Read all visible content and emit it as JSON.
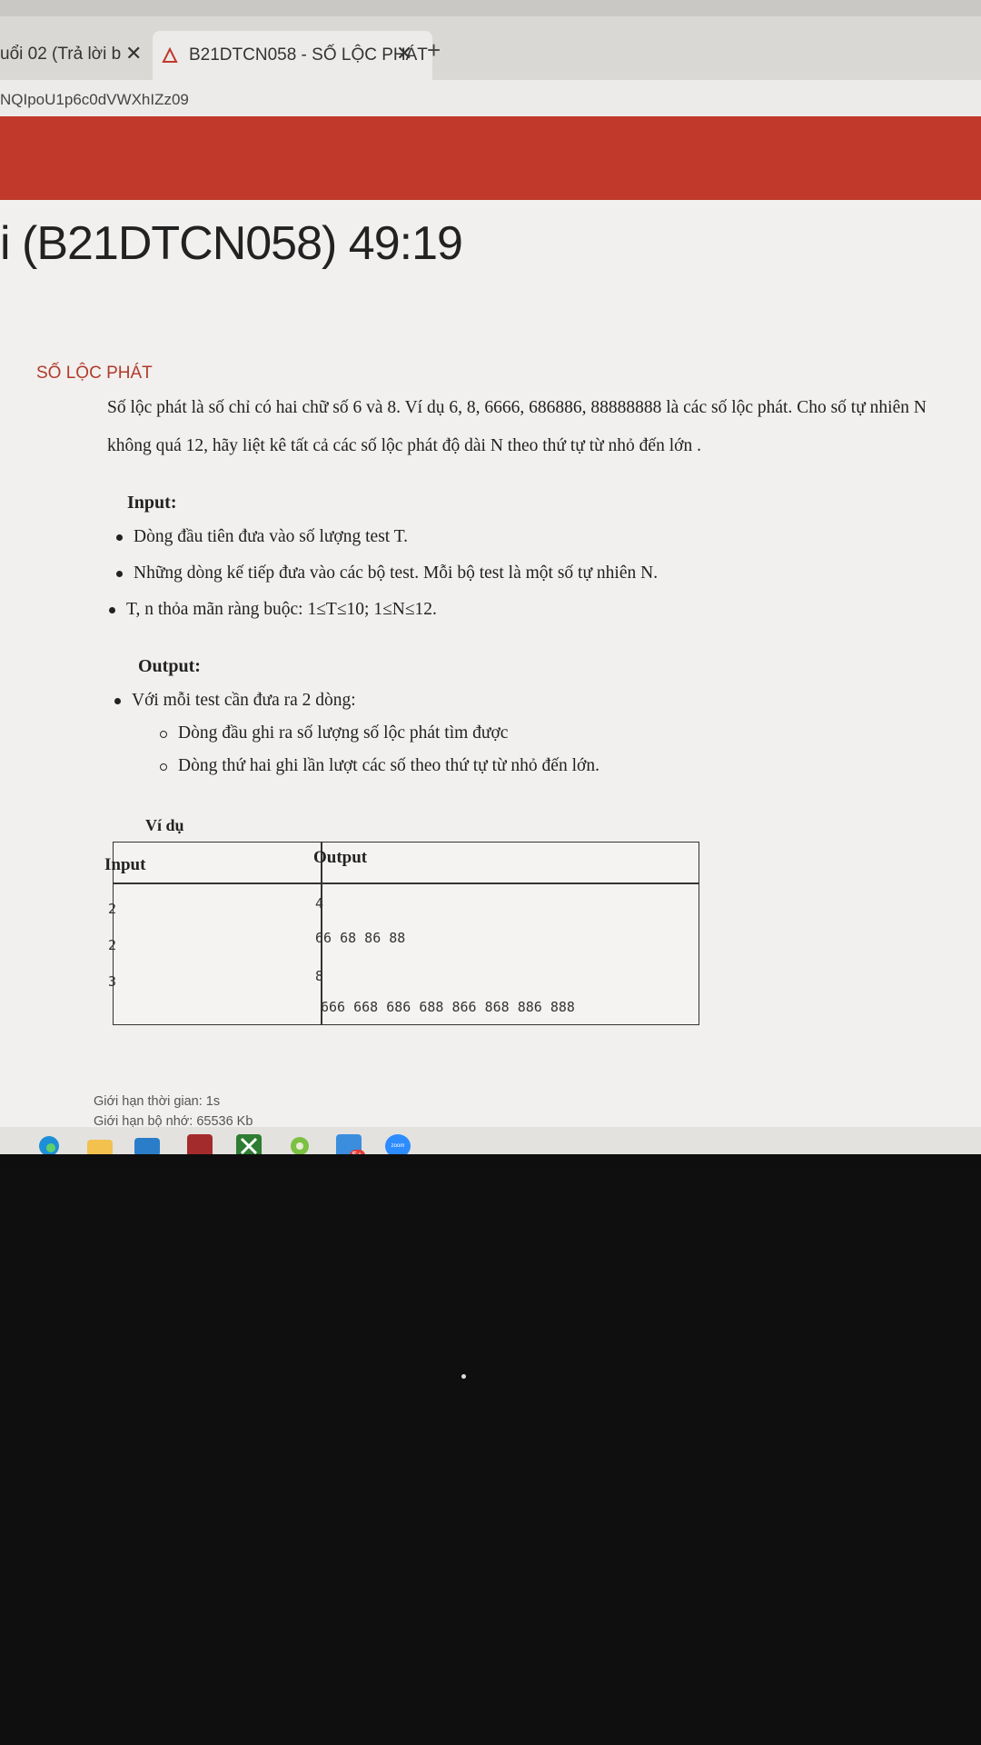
{
  "browser": {
    "tabs": [
      {
        "label": "uổi 02 (Trả lời b",
        "close": "✕"
      },
      {
        "label": "B21DTCN058 - SỐ LỘC PHÁT",
        "close": "✕"
      }
    ],
    "new_tab": "+",
    "url": "NQIpoU1p6c0dVWXhIZz09"
  },
  "page": {
    "title": "i (B21DTCN058) 49:19",
    "problem_name": "SỐ LỘC PHÁT",
    "description_line1": "Số lộc phát là số chỉ có hai chữ số 6 và 8. Ví dụ 6, 8, 6666, 686886, 88888888 là các số lộc phát. Cho số tự nhiên N",
    "description_line2": "không quá 12, hãy liệt kê tất cả các số lộc phát độ dài N theo thứ tự từ nhỏ đến lớn .",
    "input_heading": "Input:",
    "input_items": [
      "Dòng đầu tiên đưa vào số lượng test T.",
      "Những dòng kế tiếp đưa vào các bộ test. Mỗi bộ test là một số tự nhiên N.",
      "T, n thỏa mãn ràng buộc: 1≤T≤10; 1≤N≤12."
    ],
    "output_heading": "Output:",
    "output_item": "Với mỗi test cần đưa ra 2 dòng:",
    "output_subitems": [
      "Dòng đầu ghi ra số lượng số lộc phát tìm được",
      "Dòng thứ hai ghi lần lượt các số theo thứ tự từ nhỏ đến lớn."
    ],
    "example_heading": "Ví dụ",
    "table": {
      "header_input": "Input",
      "header_output": "Output",
      "input_lines": [
        "2",
        "2",
        "3"
      ],
      "output_lines": [
        "4",
        "66  68  86  88",
        "8",
        "666  668  686  688  866  868  886  888"
      ]
    },
    "time_limit": "Giới hạn thời gian: 1s",
    "memory_limit": "Giới hạn bộ nhớ: 65536 Kb"
  },
  "taskbar": {
    "icons": [
      "edge-icon",
      "file-explorer-icon",
      "mail-icon",
      "app-icon",
      "xbox-icon",
      "app-green-icon",
      "badge-app-icon",
      "zoom-icon"
    ],
    "zoom_label": "zoom",
    "badge": "5+"
  },
  "colors": {
    "banner": "#c0392b",
    "problem_name": "#b23a2b"
  }
}
